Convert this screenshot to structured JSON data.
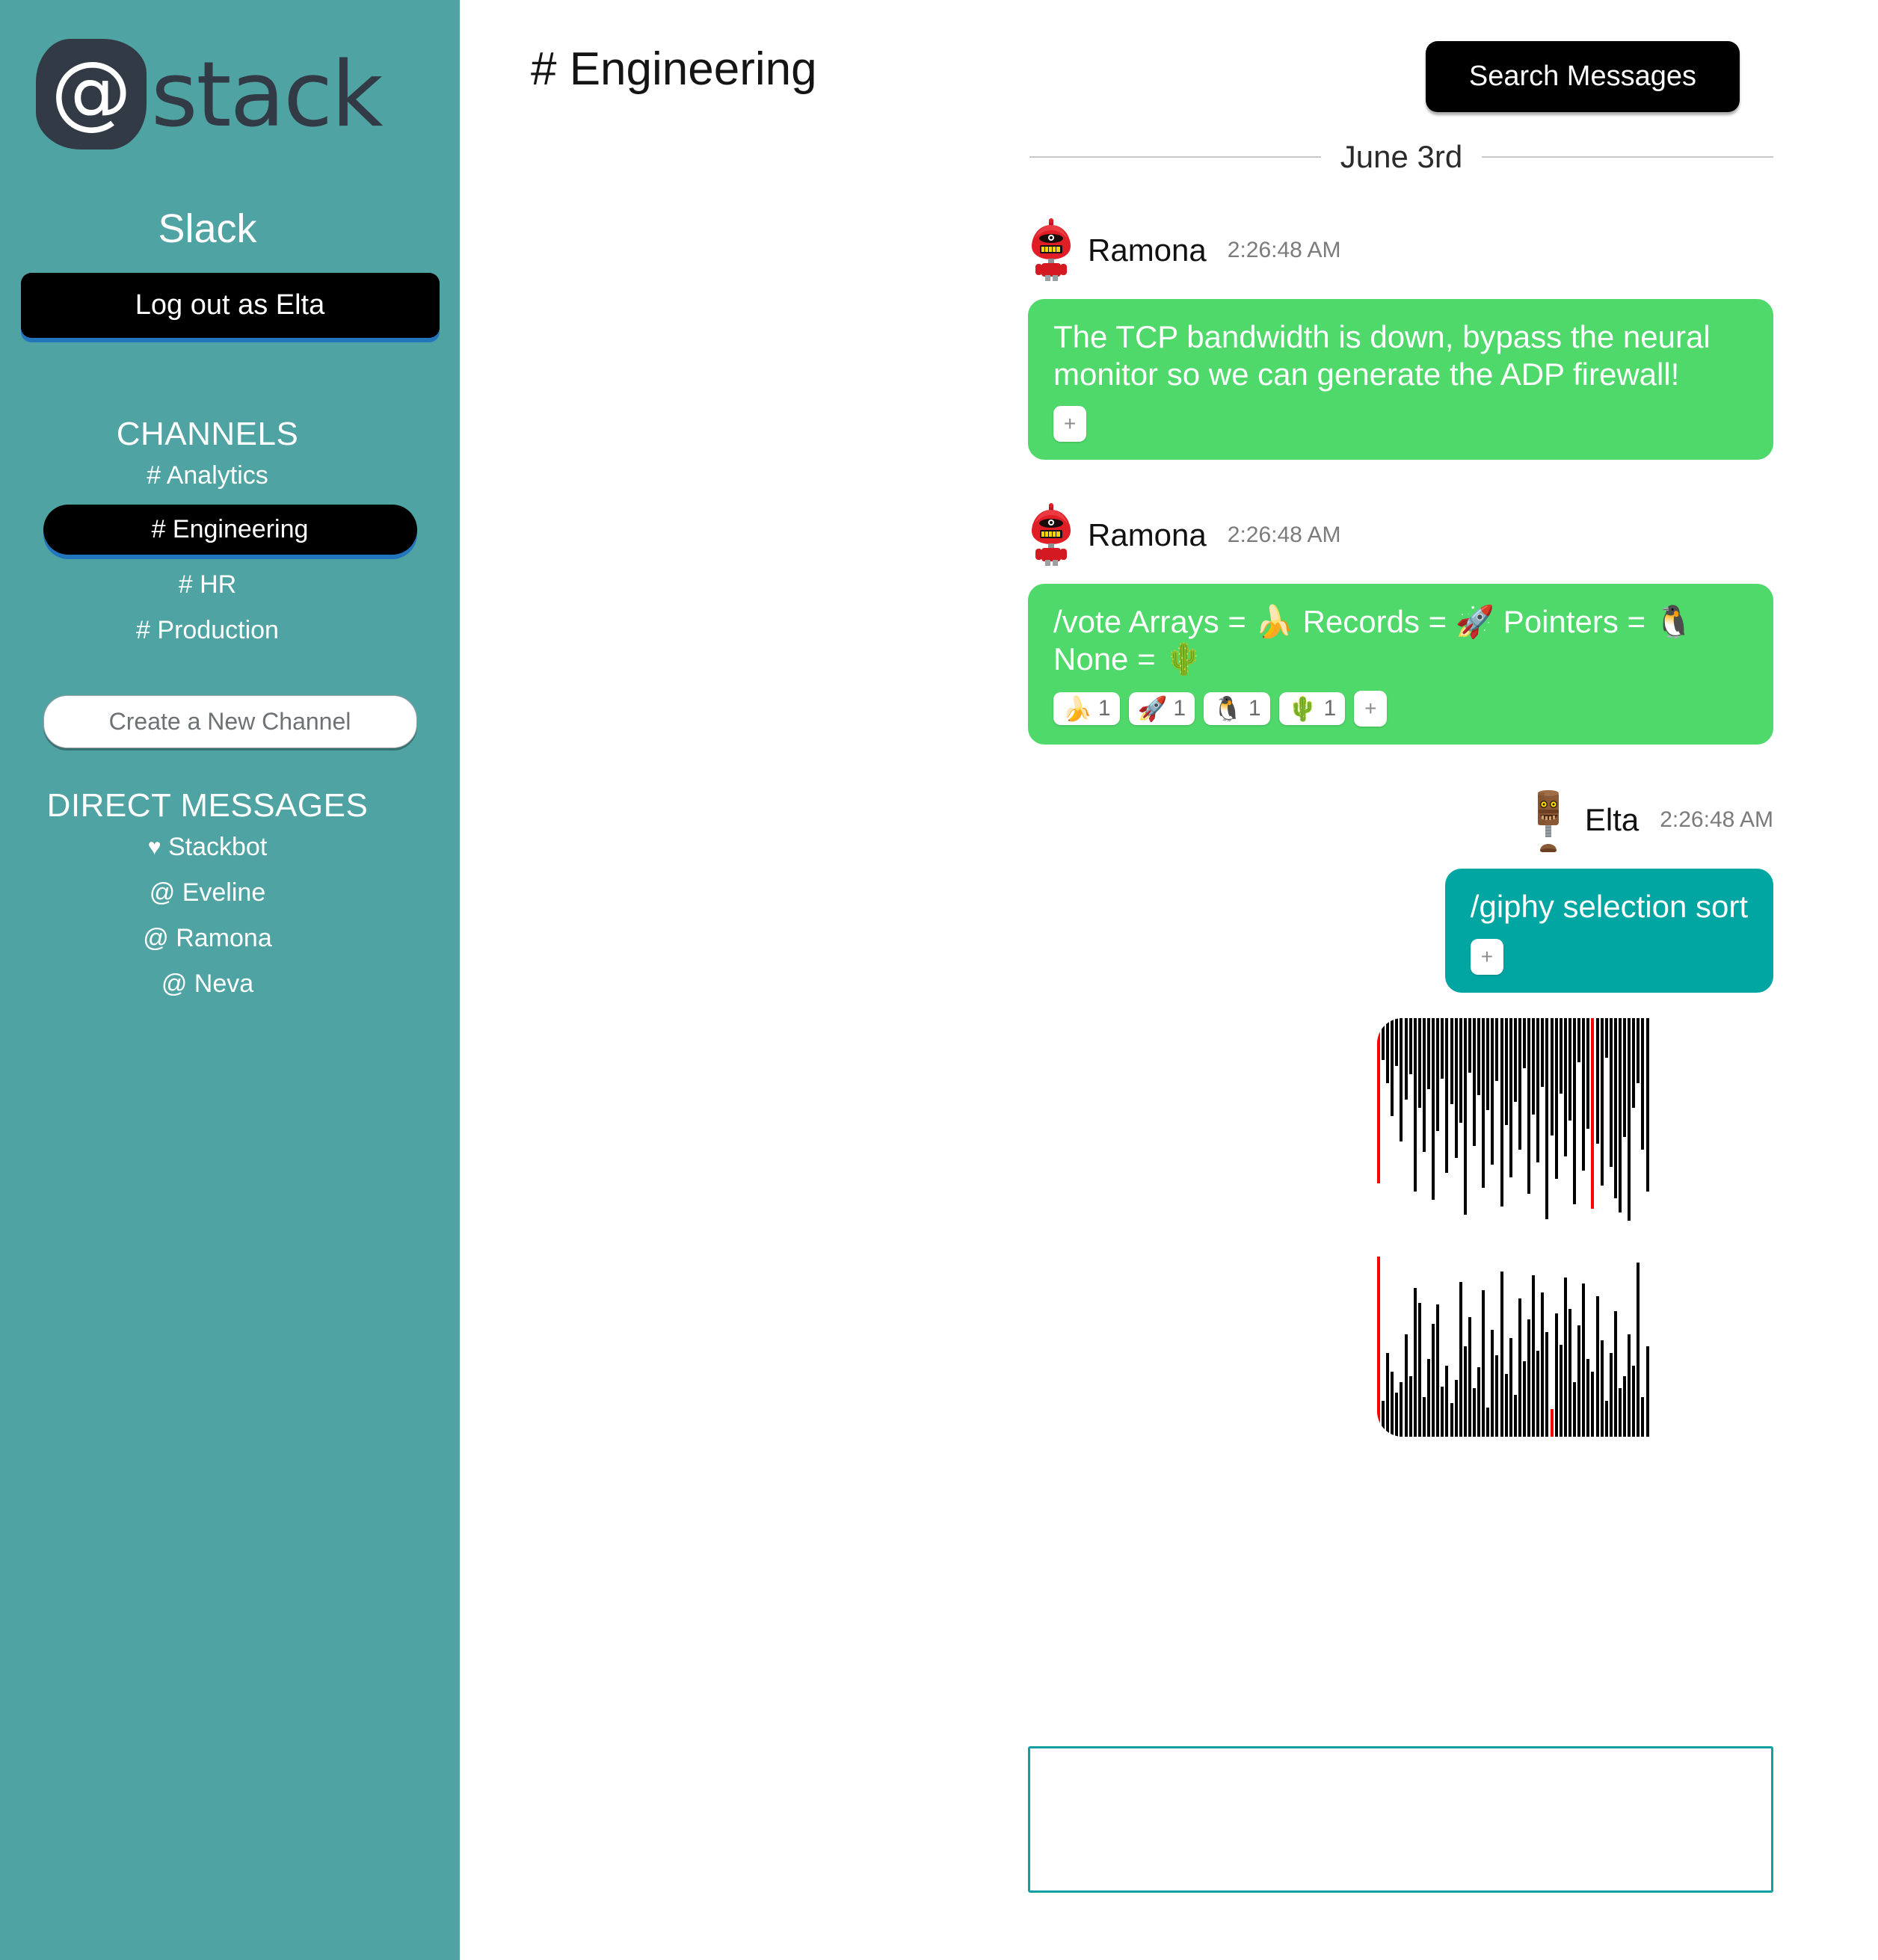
{
  "app": {
    "logo_at": "@",
    "logo_word": "stack",
    "workspace_name": "Slack",
    "logout_label": "Log out as Elta"
  },
  "sidebar": {
    "channels_heading": "CHANNELS",
    "channels": [
      {
        "label": "# Analytics",
        "active": false
      },
      {
        "label": "# Engineering",
        "active": true
      },
      {
        "label": "# HR",
        "active": false
      },
      {
        "label": "# Production",
        "active": false
      }
    ],
    "new_channel_placeholder": "Create a New Channel",
    "new_channel_value": "",
    "dm_heading": "DIRECT MESSAGES",
    "dms": [
      {
        "icon": "heart-icon",
        "glyph": "♥",
        "label": "Stackbot"
      },
      {
        "icon": "at-icon",
        "glyph": "@",
        "label": "Eveline"
      },
      {
        "icon": "at-icon",
        "glyph": "@",
        "label": "Ramona"
      },
      {
        "icon": "at-icon",
        "glyph": "@",
        "label": "Neva"
      }
    ]
  },
  "header": {
    "channel_title": "# Engineering",
    "search_label": "Search Messages"
  },
  "conversation": {
    "date_label": "June 3rd",
    "messages": [
      {
        "author": "Ramona",
        "time": "2:26:48 AM",
        "side": "left",
        "avatar": "red-robot-avatar",
        "text": "The TCP bandwidth is down, bypass the neural monitor so we can generate the ADP firewall!",
        "reactions": [],
        "add_reaction_label": "+"
      },
      {
        "author": "Ramona",
        "time": "2:26:48 AM",
        "side": "left",
        "avatar": "red-robot-avatar",
        "text": "/vote Arrays = 🍌 Records = 🚀 Pointers = 🐧 None = 🌵",
        "reactions": [
          {
            "emoji": "🍌",
            "name": "banana-reaction",
            "count": "1"
          },
          {
            "emoji": "🚀",
            "name": "rocket-reaction",
            "count": "1"
          },
          {
            "emoji": "🐧",
            "name": "penguin-reaction",
            "count": "1"
          },
          {
            "emoji": "🌵",
            "name": "cactus-reaction",
            "count": "1"
          }
        ],
        "add_reaction_label": "+"
      },
      {
        "author": "Elta",
        "time": "2:26:48 AM",
        "side": "right",
        "avatar": "wood-robot-avatar",
        "text": "/giphy selection sort",
        "reactions": [],
        "add_reaction_label": "+",
        "attachment": "selection-sort-gif"
      }
    ]
  },
  "composer": {
    "value": "",
    "placeholder": ""
  },
  "colors": {
    "sidebar": "#4FA3A2",
    "bubble_other": "#4ED96A",
    "bubble_self": "#01A5A2",
    "button_black": "#000000",
    "button_shadow_blue": "#2176BD",
    "composer_border": "#11A0A0",
    "logo_dark": "#323A45",
    "gif_bar": "#000000",
    "gif_bar_highlight": "#FF0000"
  },
  "chart_data": {
    "type": "bar",
    "title": "selection sort visualization (animated gif)",
    "xlabel": "",
    "ylabel": "",
    "notes": "two stacked panels of vertical bars; top panel bars hang from the top edge, bottom panel bars rise from the bottom edge; a few bars are highlighted red",
    "series": [
      {
        "name": "top-panel",
        "anchor": "top",
        "values": [
          55,
          14,
          22,
          33,
          16,
          41,
          27,
          19,
          58,
          30,
          45,
          24,
          61,
          38,
          20,
          52,
          29,
          47,
          35,
          66,
          18,
          43,
          26,
          57,
          31,
          49,
          21,
          63,
          36,
          53,
          28,
          44,
          17,
          59,
          32,
          48,
          23,
          67,
          39,
          54,
          25,
          46,
          34,
          62,
          15,
          51,
          37,
          64,
          42,
          56,
          13,
          50,
          60,
          65,
          40,
          68,
          30,
          22,
          44,
          58
        ],
        "highlight_indexes": [
          0,
          47
        ]
      },
      {
        "name": "bottom-panel",
        "anchor": "bottom",
        "values": [
          60,
          12,
          28,
          22,
          15,
          18,
          34,
          20,
          50,
          45,
          13,
          26,
          38,
          44,
          17,
          24,
          11,
          19,
          52,
          30,
          40,
          16,
          23,
          49,
          10,
          36,
          27,
          55,
          21,
          33,
          14,
          46,
          25,
          39,
          54,
          29,
          48,
          35,
          9,
          41,
          31,
          53,
          43,
          18,
          37,
          51,
          26,
          22,
          47,
          32,
          12,
          28,
          42,
          16,
          20,
          34,
          24,
          58,
          13,
          30
        ],
        "highlight_indexes": [
          0,
          38
        ]
      }
    ]
  }
}
